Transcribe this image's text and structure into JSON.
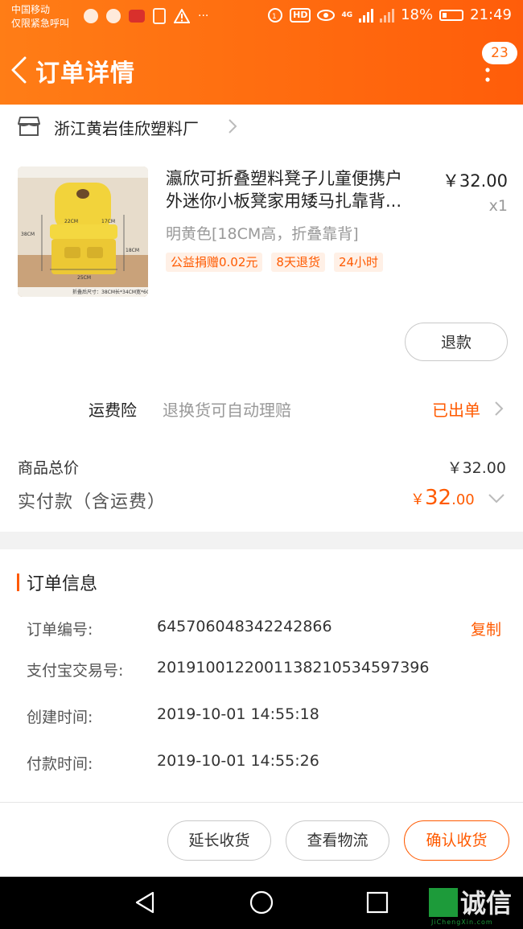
{
  "status_bar": {
    "carrier_line1": "中国移动",
    "carrier_line2": "仅限紧急呼叫",
    "hd": "HD",
    "net": "4G",
    "battery_pct": "18%",
    "time": "21:49",
    "more": "···"
  },
  "nav": {
    "title": "订单详情",
    "message_badge": "23"
  },
  "shop": {
    "name": "浙江黄岩佳欣塑料厂"
  },
  "product": {
    "title_line1": "瀛欣可折叠塑料凳子儿童便携户",
    "title_line2": "外迷你小板凳家用矮马扎靠背...",
    "price": "￥32.00",
    "quantity": "x1",
    "spec": "明黄色[18CM高，折叠靠背]",
    "tags": [
      "公益捐赠0.02元",
      "8天退货",
      "24小时"
    ],
    "refund_label": "退款",
    "image_caption": "折叠后尺寸：38CM长*34CM宽*6CM厚",
    "dims": [
      "22CM",
      "17CM",
      "38CM",
      "18CM",
      "25CM"
    ]
  },
  "insurance": {
    "label": "运费险",
    "desc": "退换货可自动理赔",
    "status": "已出单"
  },
  "totals": {
    "goods_label": "商品总价",
    "goods_value": "￥32.00",
    "paid_label": "实付款（含运费）",
    "paid_currency": "￥",
    "paid_int": "32",
    "paid_dec": ".00"
  },
  "order_info": {
    "title": "订单信息",
    "order_no_label": "订单编号:",
    "order_no": "645706048342242866",
    "copy_label": "复制",
    "alipay_label": "支付宝交易号:",
    "alipay_no": "2019100122001138210534597396",
    "created_label": "创建时间:",
    "created": "2019-10-01 14:55:18",
    "paid_time_label": "付款时间:",
    "paid_time": "2019-10-01 14:55:26"
  },
  "actions": {
    "extend": "延长收货",
    "logistics": "查看物流",
    "confirm": "确认收货"
  },
  "watermark": {
    "text": "诚信",
    "sub": "JiChengXin.com"
  },
  "colors": {
    "header_start": "#ff7d16",
    "header_end": "#ff5d0a",
    "accent": "#ff5a00"
  }
}
